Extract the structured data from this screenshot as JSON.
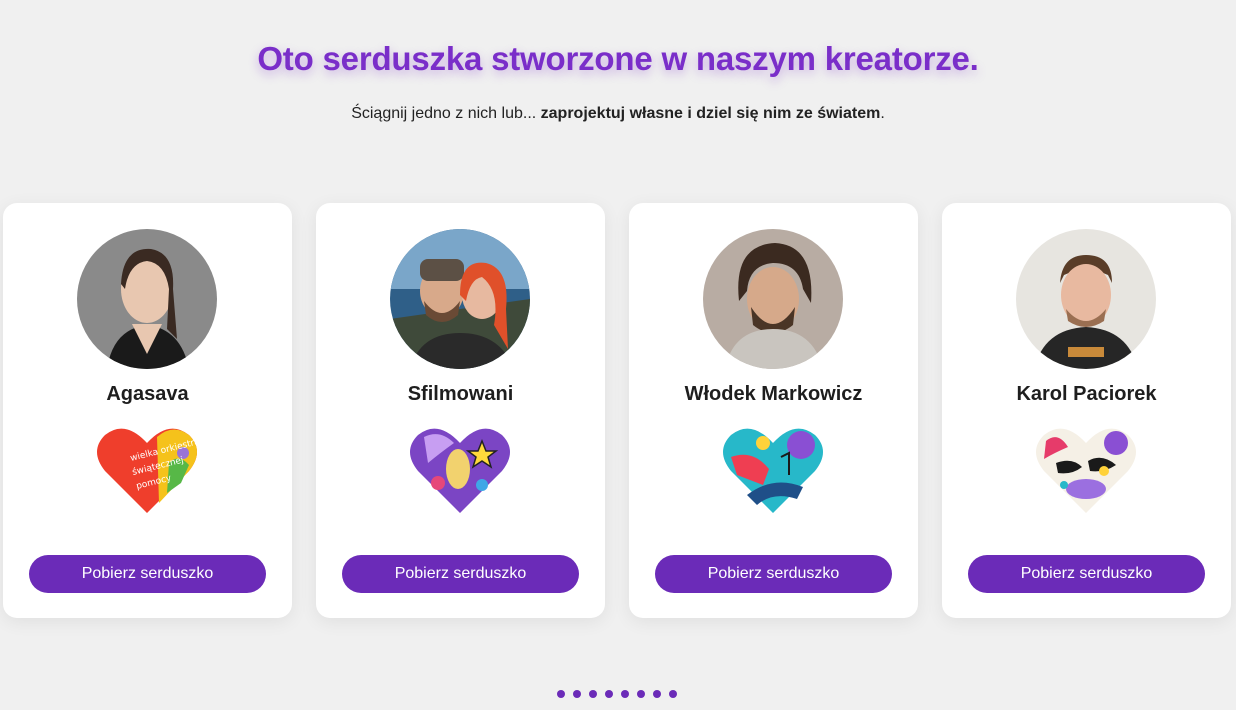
{
  "header": {
    "title": "Oto serduszka stworzone w naszym kreatorze.",
    "subtitle_plain": "Ściągnij jedno z nich lub... ",
    "subtitle_bold": "zaprojektuj własne i dziel się nim ze światem",
    "subtitle_end": "."
  },
  "cards": [
    {
      "name": "Agasava",
      "button_label": "Pobierz serduszko",
      "heart_text": "wielka orkiestra świątecznej pomocy"
    },
    {
      "name": "Sfilmowani",
      "button_label": "Pobierz serduszko"
    },
    {
      "name": "Włodek Markowicz",
      "button_label": "Pobierz serduszko"
    },
    {
      "name": "Karol Paciorek",
      "button_label": "Pobierz serduszko"
    }
  ],
  "carousel": {
    "dot_count": 8
  },
  "colors": {
    "accent": "#6b2bb8",
    "title": "#7a2ec9",
    "background": "#f0f0f0",
    "card": "#ffffff"
  }
}
